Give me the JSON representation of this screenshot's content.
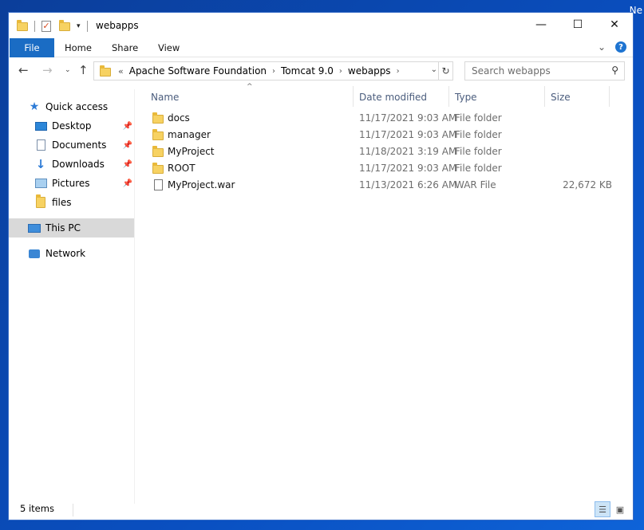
{
  "desktop": {
    "corner_label": "Ne"
  },
  "window": {
    "title": "webapps",
    "controls": {
      "minimize": "—",
      "maximize": "☐",
      "close": "✕"
    }
  },
  "ribbon": {
    "tabs": [
      "File",
      "Home",
      "Share",
      "View"
    ]
  },
  "address": {
    "overflow": "«",
    "crumbs": [
      "Apache Software Foundation",
      "Tomcat 9.0",
      "webapps"
    ],
    "search_placeholder": "Search webapps"
  },
  "nav": {
    "quick_access": "Quick access",
    "items": [
      "Desktop",
      "Documents",
      "Downloads",
      "Pictures",
      "files"
    ],
    "this_pc": "This PC",
    "network": "Network"
  },
  "columns": {
    "name": "Name",
    "date": "Date modified",
    "type": "Type",
    "size": "Size"
  },
  "files": [
    {
      "name": "docs",
      "date": "11/17/2021 9:03 AM",
      "type": "File folder",
      "size": ""
    },
    {
      "name": "manager",
      "date": "11/17/2021 9:03 AM",
      "type": "File folder",
      "size": ""
    },
    {
      "name": "MyProject",
      "date": "11/18/2021 3:19 AM",
      "type": "File folder",
      "size": ""
    },
    {
      "name": "ROOT",
      "date": "11/17/2021 9:03 AM",
      "type": "File folder",
      "size": ""
    },
    {
      "name": "MyProject.war",
      "date": "11/13/2021 6:26 AM",
      "type": "WAR File",
      "size": "22,672 KB"
    }
  ],
  "status": {
    "count": "5 items"
  },
  "colors": {
    "accent": "#1a6cc4",
    "selected": "#d9d9d9",
    "header_text": "#4b5d7d"
  }
}
